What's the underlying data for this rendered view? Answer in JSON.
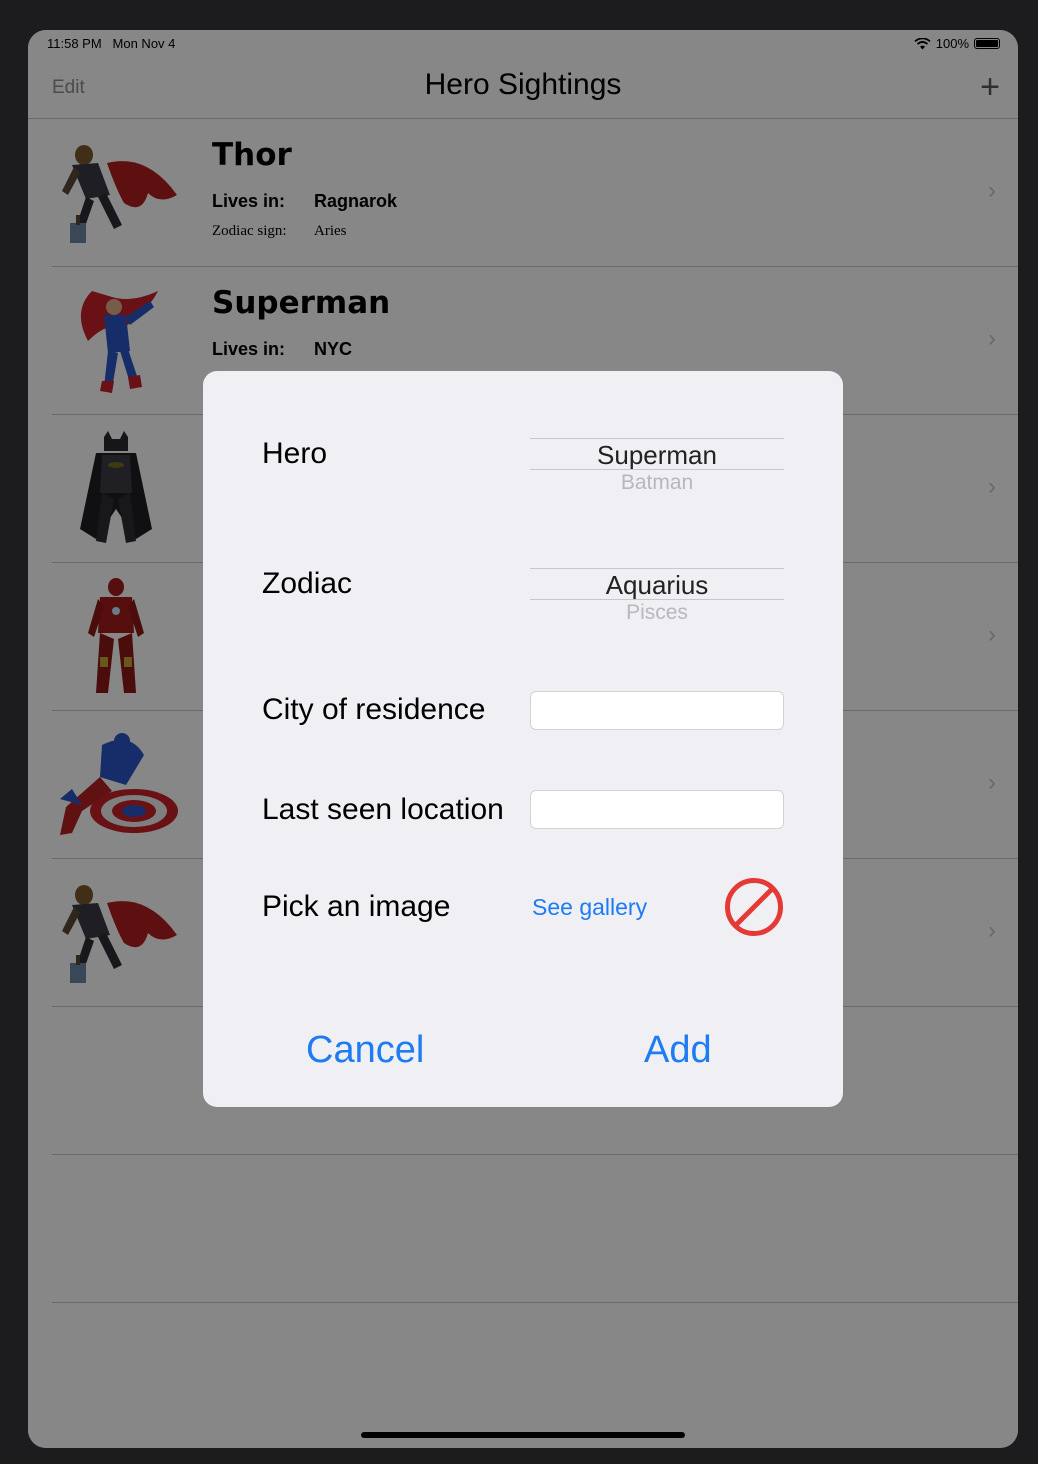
{
  "status_bar": {
    "time": "11:58 PM",
    "date": "Mon Nov 4",
    "wifi_icon": "wifi-icon",
    "battery": "100%"
  },
  "nav": {
    "edit": "Edit",
    "title": "Hero Sightings",
    "add": "+"
  },
  "rows": [
    {
      "name": "Thor",
      "lives_label": "Lives in:",
      "lives": "Ragnarok",
      "zodiac_label": "Zodiac sign:",
      "zodiac": "Aries"
    },
    {
      "name": "Superman",
      "lives_label": "Lives in:",
      "lives": "NYC"
    }
  ],
  "chevron": "›",
  "modal": {
    "hero_label": "Hero",
    "hero_selected": "Superman",
    "hero_next": "Batman",
    "zodiac_label": "Zodiac",
    "zodiac_selected": "Aquarius",
    "zodiac_next": "Pisces",
    "city_label": "City of residence",
    "city_value": "",
    "last_seen_label": "Last seen location",
    "last_seen_value": "",
    "image_label": "Pick an image",
    "gallery_link": "See gallery",
    "no_image_icon": "no-image-icon",
    "cancel": "Cancel",
    "add": "Add"
  },
  "colors": {
    "accent": "#1d7cf2",
    "no_image": "#e53935",
    "modal_bg": "#efeff4"
  }
}
